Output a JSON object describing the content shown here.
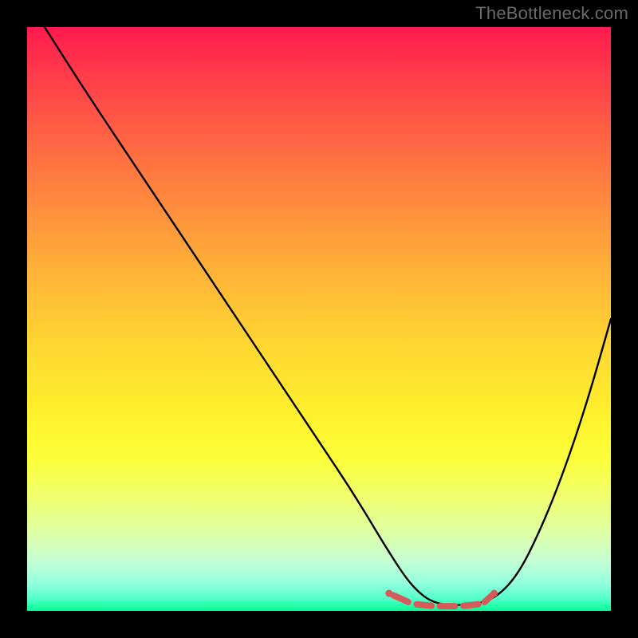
{
  "watermark": "TheBottleneck.com",
  "chart_data": {
    "type": "line",
    "title": "",
    "xlabel": "",
    "ylabel": "",
    "xlim": [
      0,
      100
    ],
    "ylim": [
      0,
      100
    ],
    "series": [
      {
        "name": "bottleneck-curve",
        "x": [
          3,
          10,
          20,
          30,
          40,
          50,
          56,
          62,
          66,
          70,
          76,
          80,
          84,
          88,
          92,
          96,
          100
        ],
        "values": [
          100,
          89,
          74,
          59,
          44,
          29,
          20,
          10,
          4,
          1,
          1,
          2,
          6,
          14,
          24,
          36,
          50
        ]
      },
      {
        "name": "optimal-range",
        "x": [
          62,
          66,
          70,
          74,
          78,
          80
        ],
        "values": [
          3,
          1.2,
          0.8,
          0.8,
          1.2,
          3
        ]
      }
    ],
    "annotations": [],
    "gradient_meaning": "red = high bottleneck, green = low/no bottleneck",
    "optimal_range_x": [
      62,
      80
    ]
  },
  "colors": {
    "curve": "#000000",
    "optimal_marker": "#d65a5a",
    "background_top": "#ff1a4d",
    "background_bottom": "#00ff91",
    "frame": "#000000"
  }
}
